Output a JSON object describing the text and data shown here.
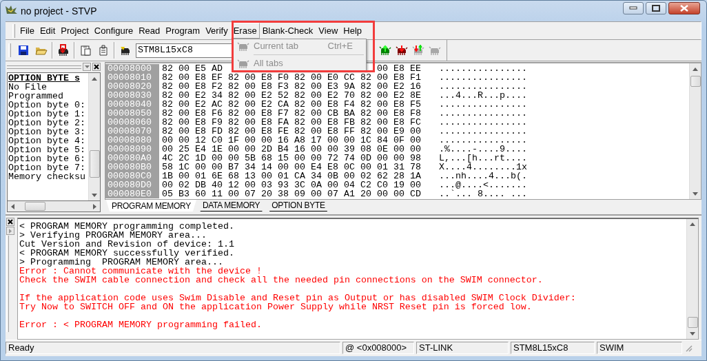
{
  "window": {
    "title": "no project - STVP"
  },
  "menu": [
    {
      "label": "File",
      "selected": false
    },
    {
      "label": "Edit",
      "selected": false
    },
    {
      "label": "Project",
      "selected": false
    },
    {
      "label": "Configure",
      "selected": false
    },
    {
      "label": "Read",
      "selected": false
    },
    {
      "label": "Program",
      "selected": false
    },
    {
      "label": "Verify",
      "selected": false
    },
    {
      "label": "Erase",
      "selected": true
    },
    {
      "label": "Blank-Check",
      "selected": false
    },
    {
      "label": "View",
      "selected": false
    },
    {
      "label": "Help",
      "selected": false
    }
  ],
  "open_menu": {
    "items": [
      {
        "kind": "command",
        "label": "Current tab",
        "shortcut": "Ctrl+E",
        "disabled": true
      },
      {
        "kind": "separator"
      },
      {
        "kind": "command",
        "label": "All tabs",
        "disabled": true
      }
    ]
  },
  "highlight_frame": true,
  "toolbar": {
    "buttons": [
      {
        "kind": "save"
      },
      {
        "kind": "open"
      },
      {
        "kind": "separator"
      },
      {
        "kind": "load"
      },
      {
        "kind": "separator"
      },
      {
        "kind": "clipboard"
      },
      {
        "kind": "document"
      },
      {
        "kind": "separator"
      },
      {
        "kind": "device"
      }
    ],
    "device_select": {
      "value": "STM8L15xC8"
    },
    "chip_buttons": [
      {
        "kind": "arrow-up",
        "disabled": false
      },
      {
        "kind": "arrow-down",
        "disabled": false
      },
      {
        "kind": "arrows",
        "disabled": false
      },
      {
        "kind": "plain",
        "disabled": true
      }
    ]
  },
  "option_panel": {
    "items": [
      {
        "kind": "heading",
        "text": "OPTION BYTE s"
      },
      {
        "kind": "line",
        "text": "No File"
      },
      {
        "kind": "line",
        "text": "Programmed"
      },
      {
        "kind": "line",
        "text": "Option byte 0:"
      },
      {
        "kind": "line",
        "text": "Option byte 1:"
      },
      {
        "kind": "line",
        "text": "Option byte 2:"
      },
      {
        "kind": "line",
        "text": "Option byte 3:"
      },
      {
        "kind": "line",
        "text": "Option byte 4:"
      },
      {
        "kind": "line",
        "text": "Option byte 5:"
      },
      {
        "kind": "line",
        "text": "Option byte 6:"
      },
      {
        "kind": "line",
        "text": "Option byte 7:"
      },
      {
        "kind": "line",
        "text": "Memory checksu"
      }
    ]
  },
  "memory_view": {
    "rows": [
      {
        "address": "00008000",
        "bytes_left": "82 00 E5 AD",
        "bytes_right": "00 E8 EE",
        "ascii": "................"
      },
      {
        "address": "00008010",
        "bytes": "82 00 E8 EF 82 00 E8 F0 82 00 E0 CC 82 00 E8 F1",
        "ascii": "................"
      },
      {
        "address": "00008020",
        "bytes": "82 00 E8 F2 82 00 E8 F3 82 00 E3 9A 82 00 E2 16",
        "ascii": "................"
      },
      {
        "address": "00008030",
        "bytes": "82 00 E2 34 82 00 E2 52 82 00 E2 70 82 00 E2 8E",
        "ascii": "...4...R...p...."
      },
      {
        "address": "00008040",
        "bytes": "82 00 E2 AC 82 00 E2 CA 82 00 E8 F4 82 00 E8 F5",
        "ascii": "................"
      },
      {
        "address": "00008050",
        "bytes": "82 00 E8 F6 82 00 E8 F7 82 00 CB BA 82 00 E8 F8",
        "ascii": "................"
      },
      {
        "address": "00008060",
        "bytes": "82 00 E8 F9 82 00 E8 FA 82 00 E8 FB 82 00 E8 FC",
        "ascii": "................"
      },
      {
        "address": "00008070",
        "bytes": "82 00 E8 FD 82 00 E8 FE 82 00 E8 FF 82 00 E9 00",
        "ascii": "................"
      },
      {
        "address": "00008080",
        "bytes": "00 00 12 C0 1F 00 00 16 A8 17 00 00 1C 84 0F 00",
        "ascii": "................"
      },
      {
        "address": "00008090",
        "bytes": "00 25 E4 1E 00 00 2D B4 16 00 00 39 08 0E 00 00",
        "ascii": ".%....-....9...."
      },
      {
        "address": "000080A0",
        "bytes": "4C 2C 1D 00 00 5B 68 15 00 00 72 74 0D 00 00 98",
        "ascii": "L,...[h...rt...."
      },
      {
        "address": "000080B0",
        "bytes": "58 1C 00 00 B7 34 14 00 00 E4 E8 0C 00 01 31 78",
        "ascii": "X....4........1x"
      },
      {
        "address": "000080C0",
        "bytes": "1B 00 01 6E 68 13 00 01 CA 34 0B 00 02 62 28 1A",
        "ascii": "...nh....4...b(."
      },
      {
        "address": "000080D0",
        "bytes": "00 02 DB 40 12 00 03 93 3C 0A 00 04 C2 C0 19 00",
        "ascii": "...@....<......."
      },
      {
        "address": "000080E0",
        "bytes": "05 B3 60 11 00 07 20 38 09 00 07 A1 20 00 00 CD",
        "ascii": "..`... 8.... ..."
      }
    ],
    "tabs": [
      {
        "label": "PROGRAM MEMORY",
        "selected": true
      },
      {
        "label": "DATA MEMORY",
        "selected": false
      },
      {
        "label": "OPTION BYTE",
        "selected": false
      }
    ]
  },
  "log": {
    "lines": [
      {
        "kind": "info",
        "text": "< PROGRAM MEMORY programming completed."
      },
      {
        "kind": "info",
        "text": "> Verifying PROGRAM MEMORY area..."
      },
      {
        "kind": "info",
        "text": "Cut Version and Revision of device: 1.1"
      },
      {
        "kind": "info",
        "text": "< PROGRAM MEMORY successfully verified."
      },
      {
        "kind": "info",
        "text": "> Programming  PROGRAM MEMORY area..."
      },
      {
        "kind": "error",
        "text": "Error : Cannot communicate with the device !"
      },
      {
        "kind": "error",
        "text": "Check the SWIM cable connection and check all the needed pin connections on the SWIM connector."
      },
      {
        "kind": "blank"
      },
      {
        "kind": "error",
        "text": "If the application code uses Swim Disable and Reset pin as Output or has disabled SWIM Clock Divider:"
      },
      {
        "kind": "error",
        "text": "Try Now to SWITCH OFF and ON the application Power Supply while NRST Reset pin is forced low."
      },
      {
        "kind": "blank"
      },
      {
        "kind": "error",
        "text": "Error : < PROGRAM MEMORY programming failed."
      }
    ]
  },
  "status_bar": [
    "Ready",
    "@ <0x008000>",
    "ST-LINK",
    "STM8L15xC8",
    "SWIM"
  ]
}
